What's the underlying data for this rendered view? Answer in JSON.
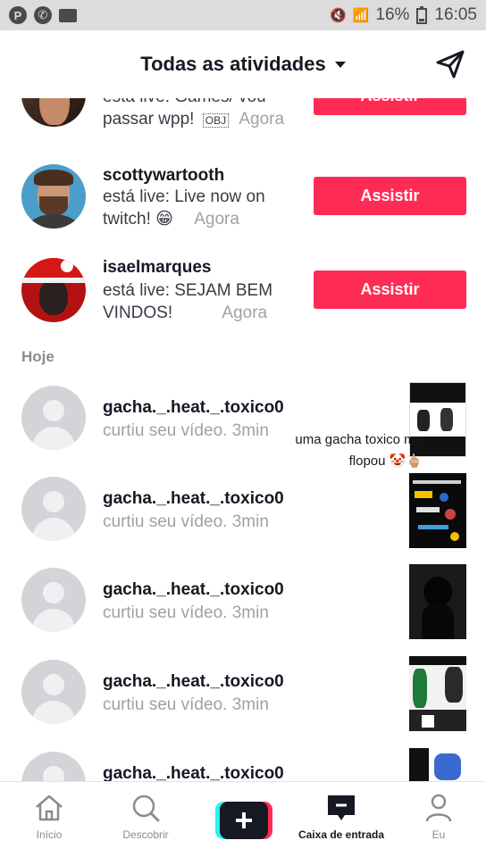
{
  "status_bar": {
    "battery": "16%",
    "time": "16:05"
  },
  "header": {
    "title": "Todas as atividades"
  },
  "live_items": [
    {
      "username": "",
      "text": "está live: Games/ vou passar wpp!",
      "time": "Agora",
      "button": "Assistir"
    },
    {
      "username": "scottywartooth",
      "text": "está live: Live now on twitch! 😁",
      "time": "Agora",
      "button": "Assistir"
    },
    {
      "username": "isaelmarques",
      "text": "está live: SEJAM BEM VINDOS!",
      "time": "Agora",
      "button": "Assistir"
    }
  ],
  "section_today": "Hoje",
  "like_items": [
    {
      "username": "gacha._.heat._.toxico0",
      "text": "curtiu seu vídeo.",
      "time": "3min"
    },
    {
      "username": "gacha._.heat._.toxico0",
      "text": "curtiu seu vídeo.",
      "time": "3min"
    },
    {
      "username": "gacha._.heat._.toxico0",
      "text": "curtiu seu vídeo.",
      "time": "3min"
    },
    {
      "username": "gacha._.heat._.toxico0",
      "text": "curtiu seu vídeo.",
      "time": "3min"
    },
    {
      "username": "gacha._.heat._.toxico0",
      "text": "",
      "time": ""
    }
  ],
  "overlay_text": {
    "line1": "uma gacha toxico me",
    "line2": "flopou 🤡🖕🏼"
  },
  "tabs": [
    {
      "label": "Início",
      "icon": "home-icon"
    },
    {
      "label": "Descobrir",
      "icon": "search-icon"
    },
    {
      "label": "",
      "icon": "plus-icon"
    },
    {
      "label": "Caixa de entrada",
      "icon": "inbox-icon"
    },
    {
      "label": "Eu",
      "icon": "profile-icon"
    }
  ],
  "colors": {
    "accent": "#fe2c55",
    "text": "#161823",
    "muted": "#a0a1a8"
  }
}
